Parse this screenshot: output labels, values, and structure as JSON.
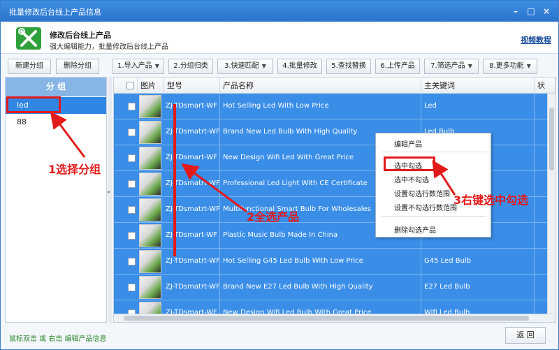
{
  "window": {
    "title": "批量修改后台线上产品信息",
    "controls": {
      "minimize": "–",
      "maximize": "□",
      "close": "×"
    }
  },
  "header": {
    "title": "修改后台线上产品",
    "subtitle": "强大编辑能力，批量修改后台线上产品",
    "help_link": "视频教程",
    "icon": "tools-icon",
    "icon_color": "#2fa13a"
  },
  "toolbar": {
    "new_group": "新建分组",
    "delete_group": "删除分组",
    "buttons": [
      {
        "label": "1.导入产品",
        "dropdown": true
      },
      {
        "label": "2.分组归类",
        "dropdown": false
      },
      {
        "label": "3.快速匹配",
        "dropdown": true
      },
      {
        "label": "4.批量修改",
        "dropdown": false
      },
      {
        "label": "5.查找替换",
        "dropdown": false
      },
      {
        "label": "6.上传产品",
        "dropdown": false
      },
      {
        "label": "7.筛选产品",
        "dropdown": true
      },
      {
        "label": "8.更多功能",
        "dropdown": true
      }
    ]
  },
  "groups": {
    "header": "分 组",
    "items": [
      "led",
      "88"
    ],
    "selected": "led"
  },
  "table": {
    "columns": [
      "图片",
      "型号",
      "产品名称",
      "主关键词",
      "状"
    ],
    "rows": [
      {
        "model": "ZJ-TDsmart-WF",
        "name": "Hot Selling Led With Low Price",
        "keyword": "Led"
      },
      {
        "model": "ZJ-TDsmatrt-WF",
        "name": "Brand New Led Bulb With High Quality",
        "keyword": "Led Bulb"
      },
      {
        "model": "ZJ-TDsmart-WF",
        "name": "New Design Wifi Led With Great Price",
        "keyword": ""
      },
      {
        "model": "ZJ-TDsmatrt-WF",
        "name": "Professional Led Light With CE Certificate",
        "keyword": ""
      },
      {
        "model": "ZJ-TDsmatrt-WF",
        "name": "Multifunctional Smart Bulb For Wholesales",
        "keyword": ""
      },
      {
        "model": "ZJ-TDsmart-WF",
        "name": "Plastic Music Bulb Made In China",
        "keyword": ""
      },
      {
        "model": "ZJ-TDsmatrt-WF",
        "name": "Hot Selling G45 Led Bulb With Low Price",
        "keyword": "G45 Led Bulb"
      },
      {
        "model": "ZJ-TDsmatrt-WF",
        "name": "Brand New E27 Led Bulb With High Quality",
        "keyword": "E27 Led Bulb"
      },
      {
        "model": "ZJ-TDsmart-WF",
        "name": "New Design Wifi Led Bulb With Great Price",
        "keyword": "Wifi Led Bulb"
      }
    ],
    "selected_color": "#3a8ee8"
  },
  "context_menu": {
    "items": [
      "编辑产品",
      "选中勾选",
      "选中不勾选",
      "设置勾选行数范围",
      "设置不勾选行数范围",
      "删除勾选产品"
    ]
  },
  "annotations": {
    "step1": "1选择分组",
    "step2": "2全选产品",
    "step3": "3右键选中勾选",
    "color": "#e31a1a"
  },
  "footer": {
    "hint": "鼠标双击 或 右击 编辑产品信息",
    "back_button": "返 回"
  }
}
